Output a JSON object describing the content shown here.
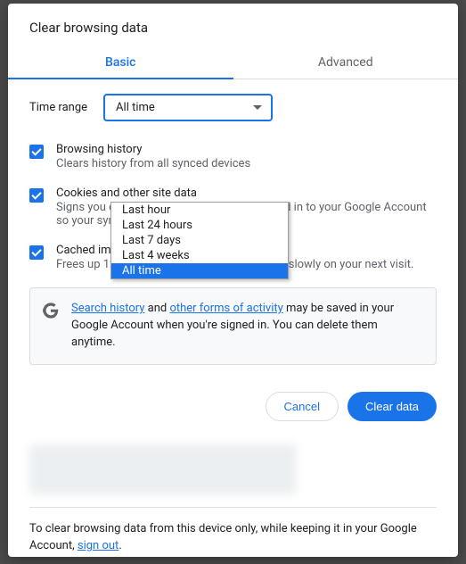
{
  "title": "Clear browsing data",
  "tabs": {
    "basic": "Basic",
    "advanced": "Advanced"
  },
  "time": {
    "label": "Time range",
    "value": "All time"
  },
  "dropdown": {
    "items": [
      "Last hour",
      "Last 24 hours",
      "Last 7 days",
      "Last 4 weeks",
      "All time"
    ],
    "selected": "All time"
  },
  "options": [
    {
      "title": "Browsing history",
      "desc": "Clears history from all synced devices"
    },
    {
      "title": "Cookies and other site data",
      "desc": "Signs you out of most sites. You'll stay signed in to your Google Account so your synced data can be cleared."
    },
    {
      "title": "Cached images and files",
      "desc": "Frees up 121 MB. Some sites may load more slowly on your next visit."
    }
  ],
  "info": {
    "link1": "Search history",
    "mid1": " and ",
    "link2": "other forms of activity",
    "tail": " may be saved in your Google Account when you're signed in. You can delete them anytime."
  },
  "buttons": {
    "cancel": "Cancel",
    "clear": "Clear data"
  },
  "footer": {
    "pre": "To clear browsing data from this device only, while keeping it in your Google Account, ",
    "link": "sign out",
    "post": "."
  }
}
